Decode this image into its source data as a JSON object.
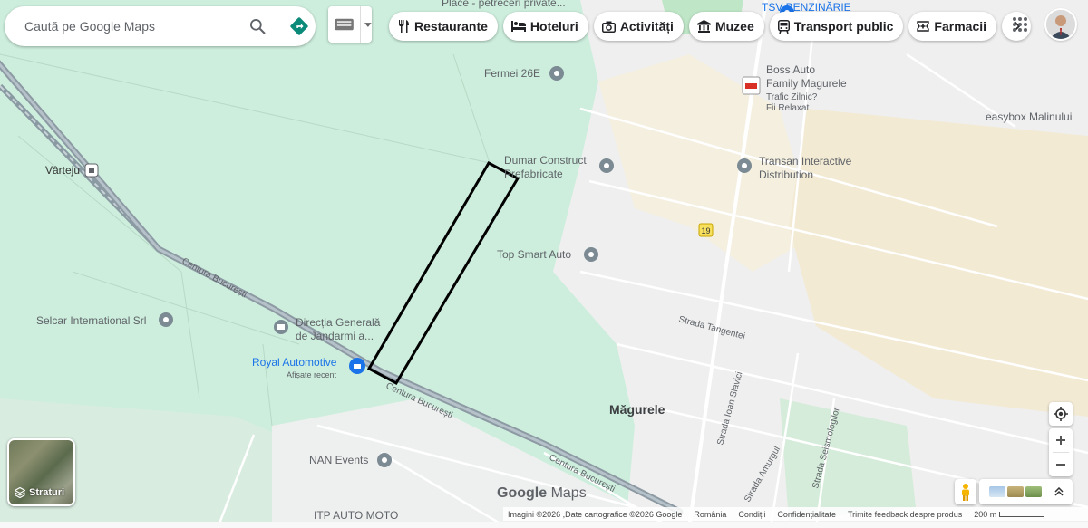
{
  "search": {
    "placeholder": "Caută pe Google Maps"
  },
  "chips": [
    {
      "label": "Restaurante",
      "icon": "restaurant-icon"
    },
    {
      "label": "Hoteluri",
      "icon": "hotel-icon"
    },
    {
      "label": "Activități",
      "icon": "camera-icon"
    },
    {
      "label": "Muzee",
      "icon": "museum-icon"
    },
    {
      "label": "Transport public",
      "icon": "transit-icon"
    },
    {
      "label": "Farmacii",
      "icon": "pharmacy-icon"
    }
  ],
  "map": {
    "places": {
      "plasce": "Place - petreceri private...",
      "tsv1": "TSV BENZINĂRIE",
      "fermei": "Fermei 26E",
      "boss1": "Boss Auto",
      "boss2": "Family Magurele",
      "trafic1": "Trafic Zilnic?",
      "trafic2": "Fii Relaxat",
      "easybox": "easybox Malinului",
      "dumar1": "Dumar Construct",
      "dumar2": "Prefabricate",
      "transan1": "Transan Interactive",
      "transan2": "Distribution",
      "varteju": "Vârteju",
      "topsmart": "Top Smart Auto",
      "selcar": "Selcar International Srl",
      "directia1": "Direcția Generală",
      "directia2": "de Jandarmi a...",
      "royal1": "Royal Automotive",
      "royal2": "Afișate recent",
      "magurele": "Măgurele",
      "nan": "NAN Events",
      "itp": "ITP AUTO MOTO",
      "road19": "19"
    },
    "roads": {
      "centura": "Centura București",
      "tangentei": "Strada Tangentei",
      "slavici": "Strada Ioan Slavici",
      "seismologilor": "Strada Seismologilor",
      "amurgului": "Strada Amurgul"
    }
  },
  "controls": {
    "layers_label": "Straturi"
  },
  "logo": {
    "google": "Google",
    "maps": "Maps"
  },
  "footer": {
    "imagery": "Imagini ©2026 ,Date cartografice ©2026 Google",
    "country": "România",
    "terms": "Condiții",
    "privacy": "Confidențialitate",
    "feedback": "Trimite feedback despre produs",
    "scale": "200 m"
  },
  "colors": {
    "green_area": "#cdeedd",
    "urban": "#efefef",
    "tan": "#f3ead4",
    "road": "#ffffff",
    "highway": "#9aa0a6",
    "poi": "#7b8a93"
  }
}
